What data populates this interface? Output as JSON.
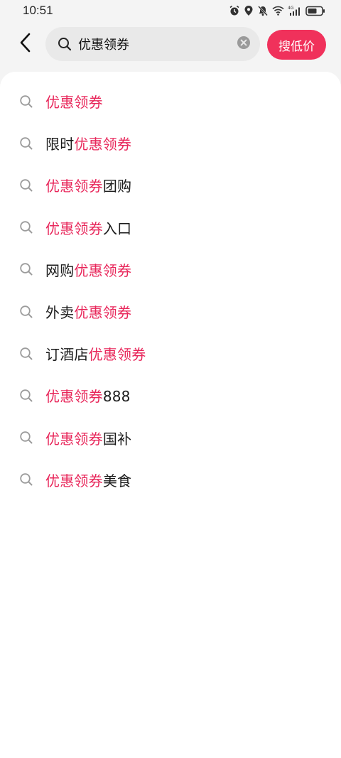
{
  "status_bar": {
    "time": "10:51",
    "network": "4G"
  },
  "search": {
    "query": "优惠领券",
    "submit_label": "搜低价"
  },
  "colors": {
    "accent": "#f0315b",
    "highlight": "#e8265a",
    "search_bg": "#e9e9e9",
    "page_bg": "#f4f4f4"
  },
  "suggestions": [
    {
      "prefix": "",
      "match": "优惠领券",
      "suffix": ""
    },
    {
      "prefix": "限时",
      "match": "优惠领券",
      "suffix": ""
    },
    {
      "prefix": "",
      "match": "优惠领券",
      "suffix": "团购"
    },
    {
      "prefix": "",
      "match": "优惠领券",
      "suffix": "入口"
    },
    {
      "prefix": "网购",
      "match": "优惠领券",
      "suffix": ""
    },
    {
      "prefix": "外卖",
      "match": "优惠领券",
      "suffix": ""
    },
    {
      "prefix": "订酒店",
      "match": "优惠领券",
      "suffix": ""
    },
    {
      "prefix": "",
      "match": "优惠领券",
      "suffix": "888"
    },
    {
      "prefix": "",
      "match": "优惠领券",
      "suffix": "国补"
    },
    {
      "prefix": "",
      "match": "优惠领券",
      "suffix": "美食"
    }
  ]
}
